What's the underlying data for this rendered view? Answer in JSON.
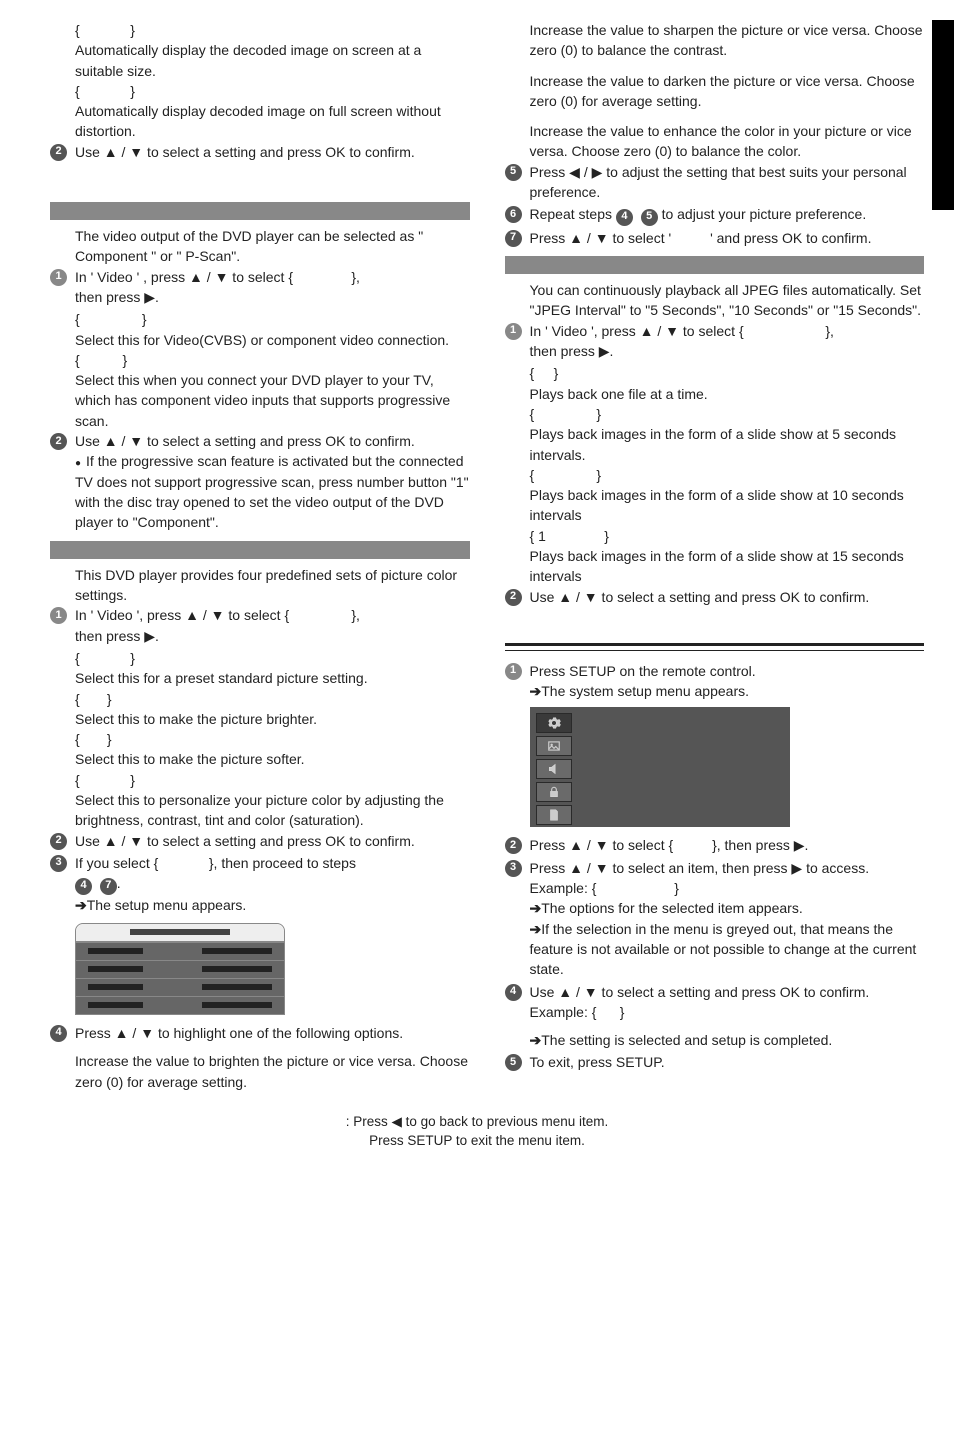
{
  "leftcol": {
    "block1": {
      "opt1_brace_open": "{",
      "opt1_brace_close": "}",
      "opt1_desc": "Automatically display the decoded image on screen at a suitable size.",
      "opt2_brace_open": "{",
      "opt2_brace_close": "}",
      "opt2_desc": "Automatically display decoded image on full screen without distortion.",
      "step2_text": "Use ▲ / ▼ to select a setting and press OK to confirm."
    },
    "block2": {
      "intro": "The video output of the DVD player can be selected as \" Component \" or \" P-Scan\".",
      "step1_prefix": "In ' Video ' , press ▲ / ▼   to select  {",
      "step1_suffix": "},",
      "step1_then": "then press  ▶.",
      "opt1_brace_open": "{",
      "opt1_brace_close": "}",
      "opt1_desc": "Select this for Video(CVBS) or component video connection.",
      "opt2_brace_open": "{",
      "opt2_brace_close": "}",
      "opt2_desc": "Select this when you connect your DVD player to your TV, which has component video inputs that supports progressive scan.",
      "step2_text": "Use ▲ / ▼ to select a setting and press OK to confirm.",
      "note": "If the progressive scan feature is activated but the connected TV does not support progressive scan, press number button \"1\" with the disc tray opened to set the video output of the DVD player to \"Component\"."
    },
    "block3": {
      "intro": "This DVD player provides four predefined sets of picture color settings.",
      "step1_prefix": "In ' Video ', press ▲ / ▼ to select {",
      "step1_suffix": "},",
      "step1_then": "then press ▶.",
      "opt1_brace_open": "{",
      "opt1_brace_close": "}",
      "opt1_desc": "Select this for a preset standard picture setting.",
      "opt2_brace_open": "{",
      "opt2_brace_close": "}",
      "opt2_desc": "Select this to make the picture brighter.",
      "opt3_brace_open": "{",
      "opt3_brace_close": "}",
      "opt3_desc": "Select this to make the picture softer.",
      "opt4_brace_open": "{",
      "opt4_brace_close": "}",
      "opt4_desc": "Select this to personalize your picture color by adjusting the brightness, contrast, tint and color (saturation).",
      "step2_text": "Use ▲ / ▼ to select a setting and press OK to confirm.",
      "step3_prefix": "If you select {",
      "step3_suffix": "}, then proceed to steps",
      "step3_after": ".",
      "setup_appears": "The setup menu appears.",
      "step4_text": "Press ▲ / ▼ to highlight one of the following options.",
      "brightness_desc": "Increase the value to brighten the picture or vice versa. Choose zero (0) for average setting."
    }
  },
  "rightcol": {
    "picture": {
      "contrast_desc": "Increase the value to sharpen the picture or vice versa.  Choose zero (0) to balance the contrast.",
      "tint_desc": "Increase the value to darken the picture or vice versa.  Choose zero (0) for average setting.",
      "color_desc": "Increase the value to enhance the color in your picture or vice versa. Choose zero (0) to balance the color.",
      "step5_text": "Press ◀  /  ▶ to adjust the setting that best suits your personal preference.",
      "step6_prefix": "Repeat steps",
      "step6_suffix": "to adjust your picture preference.",
      "step7_prefix": "Press ▲ / ▼ to select  '",
      "step7_suffix": "'  and press OK to confirm."
    },
    "jpeg": {
      "intro": "You can continuously playback all JPEG files automatically. Set \"JPEG Interval\" to \"5 Seconds\", \"10 Seconds\" or \"15 Seconds\".",
      "step1_prefix": "In ' Video ', press ▲ / ▼ to select  {",
      "step1_suffix": "},",
      "step1_then": "then press  ▶.",
      "opt1_brace_open": "{",
      "opt1_brace_close": "}",
      "opt1_desc": "Plays back one file at a time.",
      "opt2_brace_open": "{",
      "opt2_brace_close": "}",
      "opt2_desc": "Plays back images in the form of a slide show at 5 seconds intervals.",
      "opt3_brace_open": "{",
      "opt3_brace_close": "}",
      "opt3_desc": "Plays back images in the form of a slide show at 10 seconds intervals",
      "opt4_brace_open": "{ 1",
      "opt4_brace_close": "}",
      "opt4_desc": "Plays back images in the form of a slide show at 15 seconds intervals",
      "step2_text": "Use ▲ / ▼ to select a setting and press OK to confirm."
    },
    "setup": {
      "step1_text": "Press SETUP on the remote control.",
      "step1_arrow": "The system setup menu appears.",
      "step2_prefix": "Press ▲ / ▼ to select {",
      "step2_suffix": "}, then press ▶.",
      "step3_text": "Press ▲ / ▼ to select an item, then press ▶ to access.",
      "example_prefix": "Example: {",
      "example_close": "}",
      "opt_arrow_a": "The options for the selected item appears.",
      "opt_arrow_b": "If the selection in the menu is greyed out, that means the feature is not available or not possible to change at the current state.",
      "step4_text": "Use ▲ / ▼ to select a setting and press OK to confirm.",
      "example2_prefix": "Example: {",
      "example2_close": "}",
      "setting_arrow": "The setting is selected and setup is completed.",
      "step5_text": "To exit, press SETUP."
    }
  },
  "footer": {
    "line1_prefix": ":  Press ◀ to go back to previous menu item.",
    "line2": "Press SETUP to exit the menu item."
  }
}
